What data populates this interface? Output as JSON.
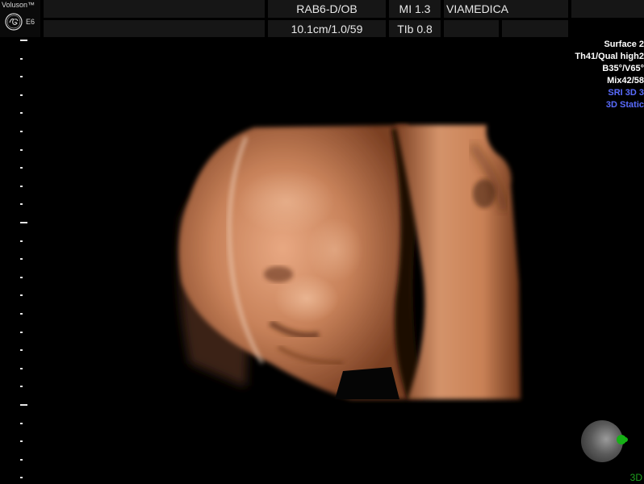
{
  "brand": {
    "name": "Voluson™",
    "logo_icon": "ge-monogram-icon",
    "model": "E6"
  },
  "header": {
    "probe": "RAB6-D/OB",
    "mi": "MI 1.3",
    "institution": "VIAMEDICA",
    "depth": "10.1cm/1.0/59",
    "tib": "TIb 0.8"
  },
  "info_panel": {
    "lines": [
      {
        "text": "Surface 2",
        "color": "#ffffff"
      },
      {
        "text": "Th41/Qual high2",
        "color": "#ffffff"
      },
      {
        "text": "B35°/V65°",
        "color": "#ffffff"
      },
      {
        "text": "Mix42/58",
        "color": "#ffffff"
      },
      {
        "text": "SRI 3D 3",
        "color": "#5a6cff"
      },
      {
        "text": "3D Static",
        "color": "#5a6cff"
      }
    ]
  },
  "orientation": {
    "ball_icon": "orientation-sphere-icon",
    "marker_icon": "probe-marker-icon",
    "mode": "3D"
  },
  "colors": {
    "background": "#000000",
    "header_cell": "#161616",
    "render_skin": "#c8825a",
    "accent_green": "#1fa21f",
    "accent_blue": "#5a6cff"
  }
}
